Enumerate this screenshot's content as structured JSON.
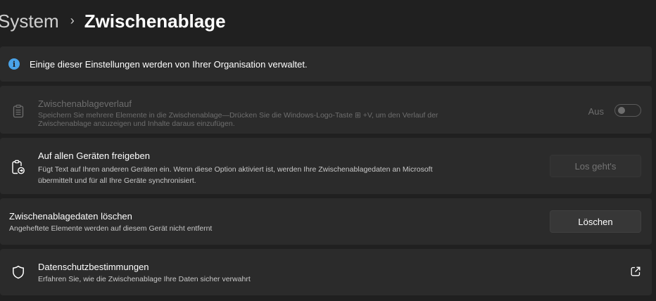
{
  "breadcrumb": {
    "parent": "System",
    "separator": "›",
    "current": "Zwischenablage"
  },
  "info_bar": {
    "icon": "info-icon",
    "icon_glyph": "i",
    "text": "Einige dieser Einstellungen werden von Ihrer Organisation verwaltet."
  },
  "clipboard_history": {
    "icon": "clipboard-icon",
    "title": "Zwischenablageverlauf",
    "description_line1": "Speichern Sie mehrere Elemente in die Zwischenablage—Drücken Sie die Windows-Logo-Taste ⊞ +V, um den Verlauf der",
    "description_line2": "Zwischenablage anzuzeigen und Inhalte daraus einzufügen.",
    "toggle_state": "Aus",
    "toggle_on": false,
    "disabled": true
  },
  "share_devices": {
    "icon": "clipboard-sync-icon",
    "title": "Auf allen Geräten freigeben",
    "description_line1": "Fügt Text auf Ihren anderen Geräten ein. Wenn diese Option aktiviert ist, werden Ihre Zwischenablagedaten an Microsoft",
    "description_line2": "übermittelt und für all Ihre Geräte synchronisiert.",
    "button_label": "Los geht's",
    "button_disabled": true
  },
  "clear_data": {
    "title": "Zwischenablagedaten löschen",
    "description": "Angeheftete Elemente werden auf diesem Gerät nicht entfernt",
    "button_label": "Löschen"
  },
  "privacy": {
    "icon": "shield-icon",
    "title": "Datenschutzbestimmungen",
    "description": "Erfahren Sie, wie die Zwischenablage Ihre Daten sicher verwahrt",
    "link_icon": "external-link-icon"
  },
  "colors": {
    "background": "#202020",
    "card": "#2b2b2b",
    "accent_info": "#4aa3e8",
    "disabled_text": "#6e6e6e"
  }
}
